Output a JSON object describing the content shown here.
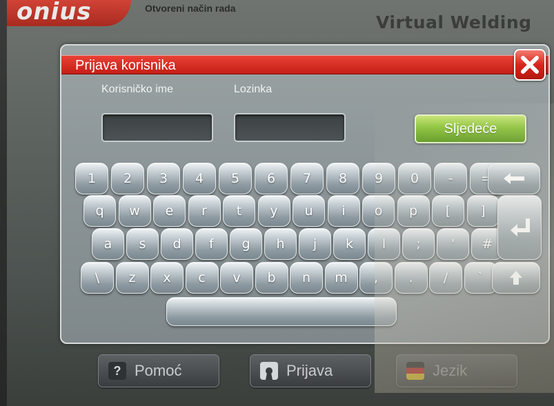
{
  "header": {
    "logo_text": "onius",
    "mode_label": "Otvoreni način rada",
    "brand": "Virtual Welding"
  },
  "dialog": {
    "title": "Prijava korisnika",
    "close_label": "X",
    "username_label": "Korisničko ime",
    "password_label": "Lozinka",
    "username_value": "",
    "password_value": "",
    "next_label": "Sljedeće"
  },
  "keyboard": {
    "row1": [
      "1",
      "2",
      "3",
      "4",
      "5",
      "6",
      "7",
      "8",
      "9",
      "0",
      "-",
      "="
    ],
    "row2": [
      "q",
      "w",
      "e",
      "r",
      "t",
      "y",
      "u",
      "i",
      "o",
      "p",
      "[",
      "]"
    ],
    "row3": [
      "a",
      "s",
      "d",
      "f",
      "g",
      "h",
      "j",
      "k",
      "l",
      ";",
      "'",
      "#"
    ],
    "row4": [
      "\\",
      "z",
      "x",
      "c",
      "v",
      "b",
      "n",
      "m",
      ",",
      ".",
      "/",
      "`"
    ],
    "backspace_icon": "backspace-arrow-icon",
    "enter_icon": "enter-return-icon",
    "shift_icon": "shift-up-arrow-icon"
  },
  "bottom_bar": {
    "help_label": "Pomoć",
    "help_icon": "question-mark-icon",
    "login_label": "Prijava",
    "login_icon": "keyhole-icon",
    "language_label": "Jezik",
    "language_icon": "flags-icon"
  }
}
